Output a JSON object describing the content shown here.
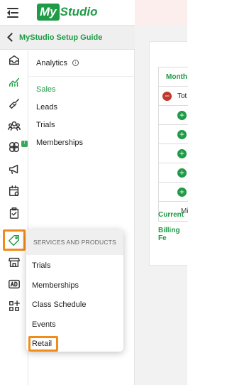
{
  "header": {
    "logo_badge": "My",
    "logo_text": "Studio",
    "menu_icon": "menu-collapse-icon"
  },
  "guide": {
    "back_icon": "chevron-left-icon",
    "label": "MyStudio Setup Guide"
  },
  "rail": {
    "icons": [
      "inbox-icon",
      "analytics-icon",
      "handshake-icon",
      "members-icon",
      "integrations-icon",
      "megaphone-icon",
      "calendar-settings-icon",
      "clipboard-check-icon",
      "tag-icon",
      "store-icon",
      "ad-icon",
      "apps-icon"
    ],
    "badge": "!"
  },
  "submenu": {
    "title": "Analytics",
    "info_icon": "info-icon",
    "items": [
      {
        "label": "Sales",
        "active": true
      },
      {
        "label": "Leads",
        "active": false
      },
      {
        "label": "Trials",
        "active": false
      },
      {
        "label": "Memberships",
        "active": false
      }
    ]
  },
  "main": {
    "table_header": "Month",
    "total_label": "Tot",
    "more_label": "Mi",
    "current_link": "Current",
    "billing_link": "Billing Fe"
  },
  "popup": {
    "header": "SERVICES AND PRODUCTS",
    "items": [
      "Trials",
      "Memberships",
      "Class Schedule",
      "Events",
      "Retail"
    ]
  },
  "colors": {
    "brand_green": "#1f9a46",
    "highlight_orange": "#f08c1a",
    "collapse_red": "#c0392b"
  }
}
